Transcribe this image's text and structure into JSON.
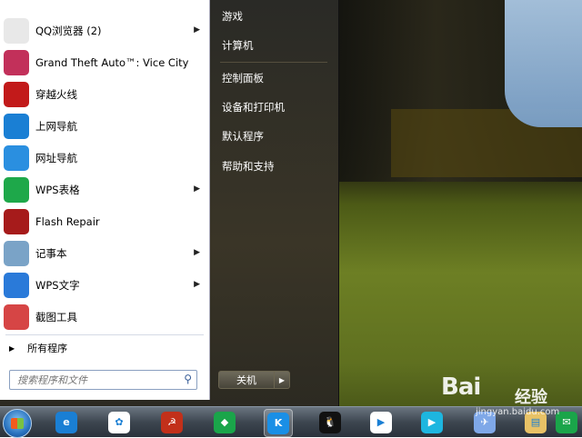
{
  "start_menu": {
    "programs": [
      {
        "label": "QQ浏览器 (2)",
        "icon": "qq-browser-icon",
        "color": "#e8e8e8",
        "has_submenu": true
      },
      {
        "label": "Grand Theft Auto™: Vice City",
        "icon": "gta-vice-city-icon",
        "color": "#c2305a",
        "has_submenu": false
      },
      {
        "label": "穿越火线",
        "icon": "crossfire-icon",
        "color": "#c21a1a",
        "has_submenu": false
      },
      {
        "label": "上网导航",
        "icon": "ie-navigation-icon",
        "color": "#1a7fd4",
        "has_submenu": false
      },
      {
        "label": "网址导航",
        "icon": "ie-url-navigation-icon",
        "color": "#2a8fe0",
        "has_submenu": false
      },
      {
        "label": "WPS表格",
        "icon": "wps-spreadsheet-icon",
        "color": "#1ea84a",
        "has_submenu": true
      },
      {
        "label": "Flash Repair",
        "icon": "flash-icon",
        "color": "#a61b1b",
        "has_submenu": false
      },
      {
        "label": "记事本",
        "icon": "notepad-icon",
        "color": "#7aa3c7",
        "has_submenu": true
      },
      {
        "label": "WPS文字",
        "icon": "wps-writer-icon",
        "color": "#2a7ad9",
        "has_submenu": true
      },
      {
        "label": "截图工具",
        "icon": "snipping-tool-icon",
        "color": "#d64545",
        "has_submenu": false
      }
    ],
    "all_programs": "所有程序",
    "search_placeholder": "搜索程序和文件",
    "right_links": [
      "游戏",
      "计算机",
      "控制面板",
      "设备和打印机",
      "默认程序",
      "帮助和支持"
    ],
    "shutdown_label": "关机"
  },
  "taskbar": {
    "items": [
      {
        "name": "internet-explorer-icon",
        "color": "#1a7fd4",
        "glyph": "e"
      },
      {
        "name": "baidu-netdisk-icon",
        "color": "#ffffff",
        "glyph": "✿"
      },
      {
        "name": "game-icon",
        "color": "#c2301a",
        "glyph": "☭"
      },
      {
        "name": "green-app-icon",
        "color": "#1aa54a",
        "glyph": "◆"
      },
      {
        "name": "k-app-icon",
        "color": "#1a8fe6",
        "glyph": "K"
      },
      {
        "name": "qq-icon",
        "color": "#111111",
        "glyph": "🐧"
      },
      {
        "name": "youku-icon",
        "color": "#ffffff",
        "glyph": "▶"
      },
      {
        "name": "video-player-icon",
        "color": "#1db6e0",
        "glyph": "▶"
      },
      {
        "name": "bird-app-icon",
        "color": "#7fa8e8",
        "glyph": "✈"
      },
      {
        "name": "explorer-folder-icon",
        "color": "#e8c266",
        "glyph": "▤"
      },
      {
        "name": "wechat-icon",
        "color": "#1aa54a",
        "glyph": "✉"
      }
    ]
  },
  "watermark": {
    "text": "Bai",
    "text2": "经验",
    "sub": "jingyan.baidu.com"
  }
}
